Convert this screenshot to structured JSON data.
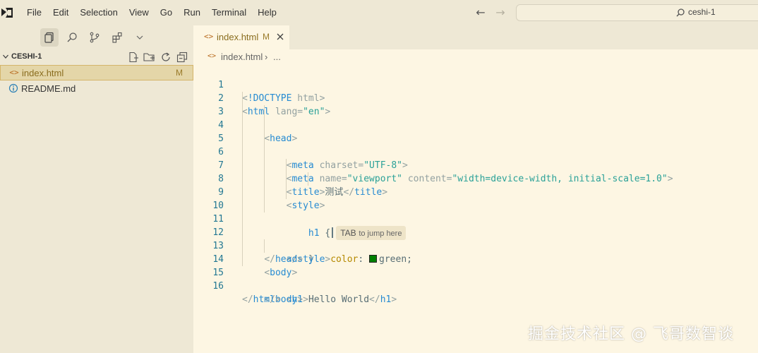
{
  "menu": [
    "File",
    "Edit",
    "Selection",
    "View",
    "Go",
    "Run",
    "Terminal",
    "Help"
  ],
  "command_center": {
    "label": "ceshi-1"
  },
  "activity_icons": [
    "explorer-icon",
    "search-icon",
    "source-control-icon",
    "extensions-icon",
    "chevron-down-icon"
  ],
  "explorer": {
    "title": "CESHI-1",
    "actions": [
      "new-file-icon",
      "new-folder-icon",
      "refresh-icon",
      "collapse-all-icon"
    ],
    "files": [
      {
        "name": "index.html",
        "status": "M",
        "icon": "html-file-icon",
        "selected": true
      },
      {
        "name": "README.md",
        "status": "",
        "icon": "info-icon",
        "selected": false
      }
    ]
  },
  "tab": {
    "label": "index.html",
    "status": "M",
    "icon_text": "<>"
  },
  "breadcrumb": {
    "file": "index.html",
    "separator": "›",
    "more": "..."
  },
  "editor": {
    "line_numbers": [
      "1",
      "2",
      "3",
      "4",
      "5",
      "6",
      "7",
      "8",
      "9",
      "10",
      "11",
      "12",
      "13",
      "14",
      "15",
      "16"
    ],
    "hint": {
      "key": "TAB",
      "text": "to jump here"
    },
    "swatch_color": "#008000"
  },
  "watermark": "掘金技术社区 @ 飞哥数智谈"
}
